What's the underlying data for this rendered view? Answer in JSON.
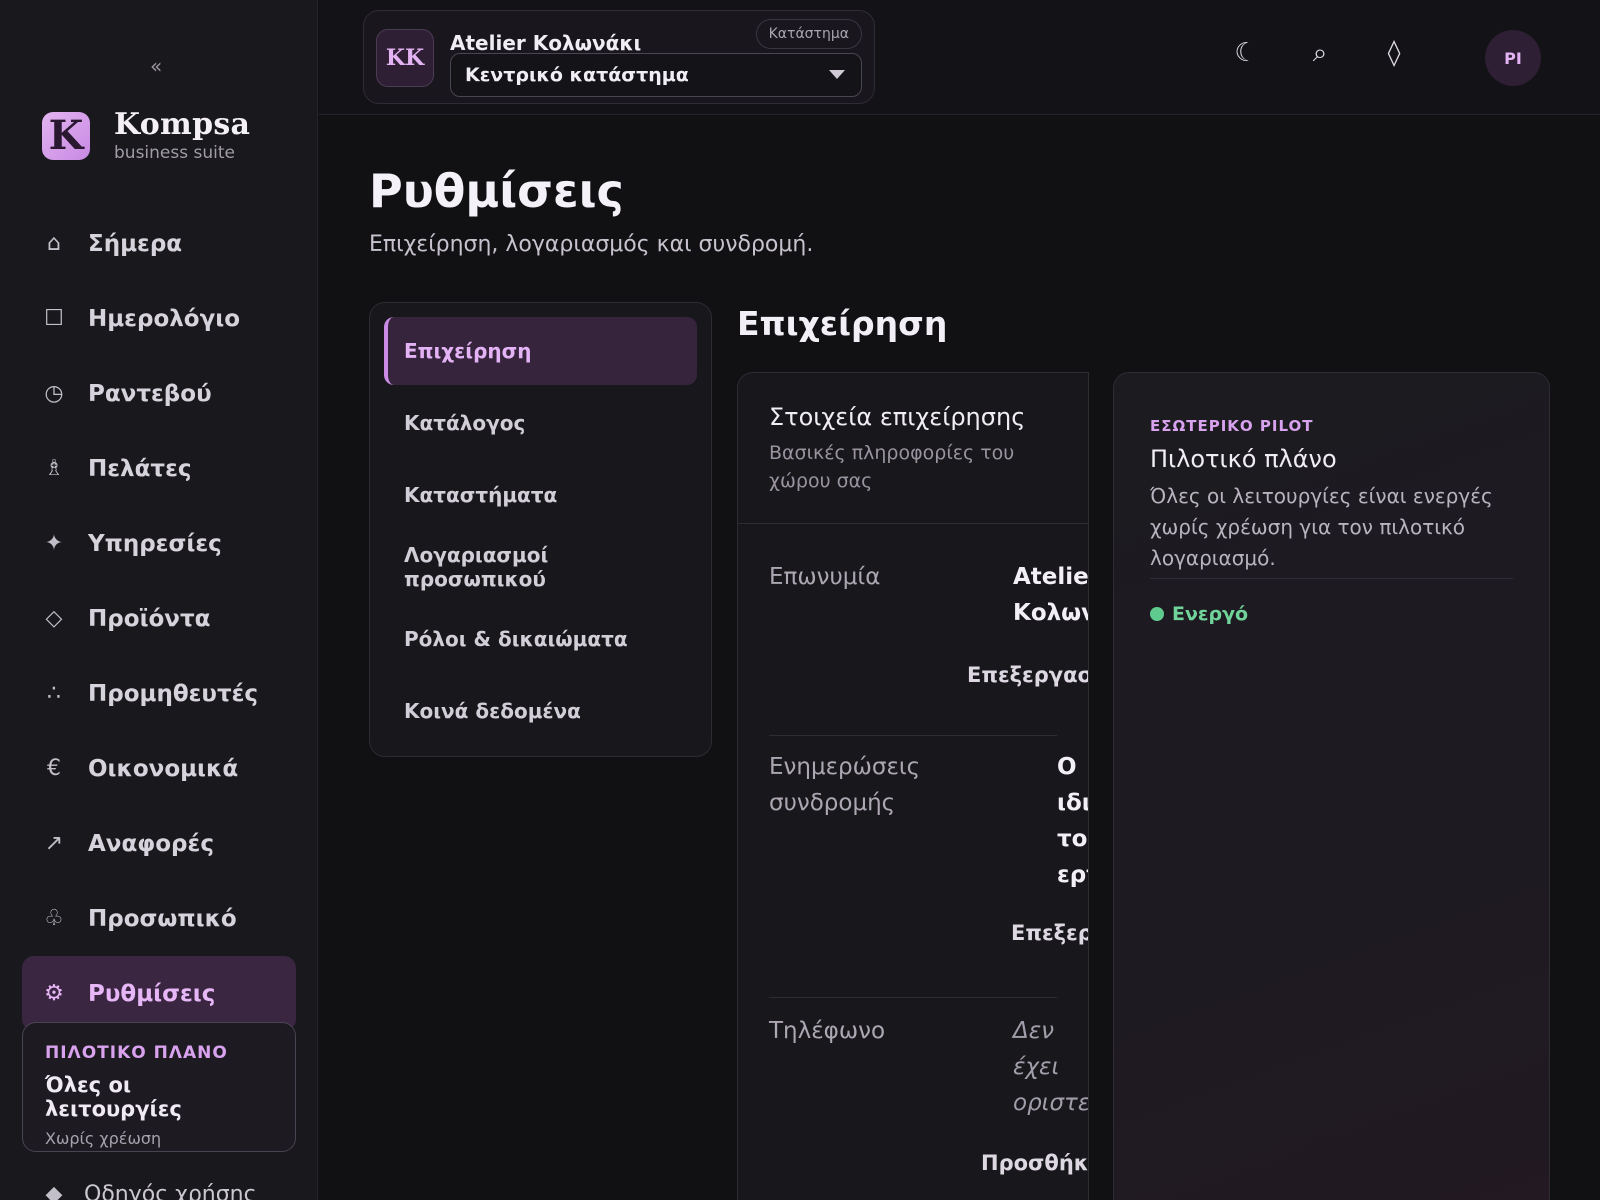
{
  "sidebar": {
    "collapse_icon": "«",
    "brand": {
      "mark": "K",
      "name": "Kompsa",
      "subtitle": "business suite"
    },
    "items": [
      {
        "icon": "home-icon",
        "glyph": "⌂",
        "label": "Σήμερα",
        "active": false
      },
      {
        "icon": "calendar-icon",
        "glyph": "☐",
        "label": "Ημερολόγιο",
        "active": false
      },
      {
        "icon": "clock-icon",
        "glyph": "◷",
        "label": "Ραντεβού",
        "active": false
      },
      {
        "icon": "customer-icon",
        "glyph": "♗",
        "label": "Πελάτες",
        "active": false
      },
      {
        "icon": "sparkle-icon",
        "glyph": "✦",
        "label": "Υπηρεσίες",
        "active": false
      },
      {
        "icon": "diamond-icon",
        "glyph": "◇",
        "label": "Προϊόντα",
        "active": false
      },
      {
        "icon": "suppliers-icon",
        "glyph": "∴",
        "label": "Προμηθευτές",
        "active": false
      },
      {
        "icon": "euro-icon",
        "glyph": "€",
        "label": "Οικονομικά",
        "active": false
      },
      {
        "icon": "arrow-up-right-icon",
        "glyph": "↗",
        "label": "Αναφορές",
        "active": false
      },
      {
        "icon": "staff-icon",
        "glyph": "♧",
        "label": "Προσωπικό",
        "active": false
      },
      {
        "icon": "gear-icon",
        "glyph": "⚙",
        "label": "Ρυθμίσεις",
        "active": true
      }
    ],
    "plan": {
      "kicker": "ΠΙΛΟΤΙΚΟ ΠΛΑΝΟ",
      "title": "Όλες οι λειτουργίες",
      "subtitle": "Χωρίς χρέωση"
    },
    "guide": {
      "icon": "guide-icon",
      "glyph": "◆",
      "label": "Οδηγός χρήσης"
    }
  },
  "topbar": {
    "store": {
      "initials": "KK",
      "name": "Atelier Κολωνάκι",
      "badge": "Κατάστημα",
      "selected": "Κεντρικό κατάστημα"
    },
    "icons": {
      "theme": "☾",
      "search": "⌕",
      "notifications": "◊"
    },
    "user_initials": "PI"
  },
  "page": {
    "title": "Ρυθμίσεις",
    "subtitle": "Επιχείρηση, λογαριασμός και συνδρομή."
  },
  "subnav": {
    "items": [
      {
        "label": "Επιχείρηση",
        "active": true
      },
      {
        "label": "Κατάλογος",
        "active": false
      },
      {
        "label": "Καταστήματα",
        "active": false
      },
      {
        "label": "Λογαριασμοί προσωπικού",
        "active": false
      },
      {
        "label": "Ρόλοι & δικαιώματα",
        "active": false
      },
      {
        "label": "Κοινά δεδομένα",
        "active": false
      }
    ]
  },
  "section": {
    "title": "Επιχείρηση",
    "card": {
      "title": "Στοιχεία επιχείρησης",
      "description": "Βασικές πληροφορίες του χώρου σας",
      "fields": [
        {
          "label": "Επωνυμία",
          "value": "Atelier Κολωνάκι",
          "action": "Επεξεργασία"
        },
        {
          "label": "Ενημερώσεις συνδρομής",
          "value": "Ο ιδιοκτήτης του χώρου εργασίας",
          "action": "Επεξεργασία"
        },
        {
          "label": "Τηλέφωνο",
          "value": "Δεν έχει οριστεί",
          "action": "Προσθήκη"
        }
      ]
    },
    "side": {
      "kicker": "ΕΣΩΤΕΡΙΚΟ PILOT",
      "title": "Πιλοτικό πλάνο",
      "description": "Όλες οι λειτουργίες είναι ενεργές χωρίς χρέωση για τον πιλοτικό λογαριασμό.",
      "status": "Ενεργό",
      "status_color": "#5fca8d"
    }
  }
}
